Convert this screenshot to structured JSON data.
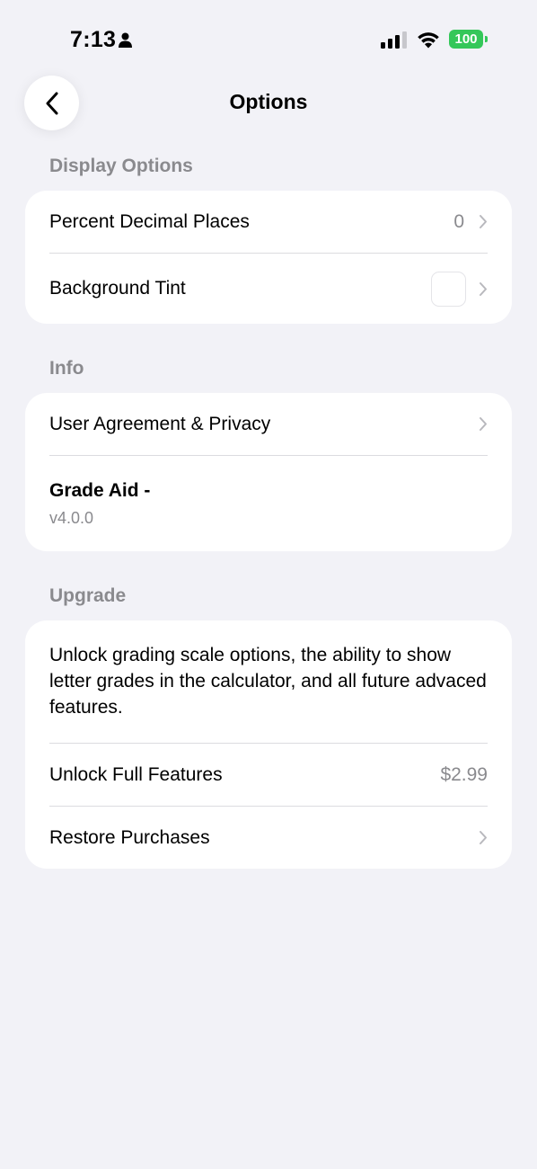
{
  "status_bar": {
    "time": "7:13",
    "battery": "100",
    "icons": [
      "person-icon",
      "signal-icon",
      "wifi-icon",
      "battery-icon"
    ]
  },
  "nav": {
    "title": "Options",
    "back_icon": "chevron-left-icon"
  },
  "sections": {
    "display": {
      "header": "Display Options",
      "percent_decimal_label": "Percent Decimal Places",
      "percent_decimal_value": "0",
      "background_tint_label": "Background Tint"
    },
    "info": {
      "header": "Info",
      "agreement_label": "User Agreement & Privacy",
      "app_name": "Grade Aid -",
      "app_version": "v4.0.0"
    },
    "upgrade": {
      "header": "Upgrade",
      "description": "Unlock grading scale options, the ability to show letter grades in the calculator, and all future advaced features.",
      "unlock_label": "Unlock Full Features",
      "unlock_price": "$2.99",
      "restore_label": "Restore Purchases"
    }
  },
  "colors": {
    "background": "#f2f2f7",
    "card": "#ffffff",
    "secondary_text": "#8a8a8e",
    "battery": "#34c759"
  }
}
